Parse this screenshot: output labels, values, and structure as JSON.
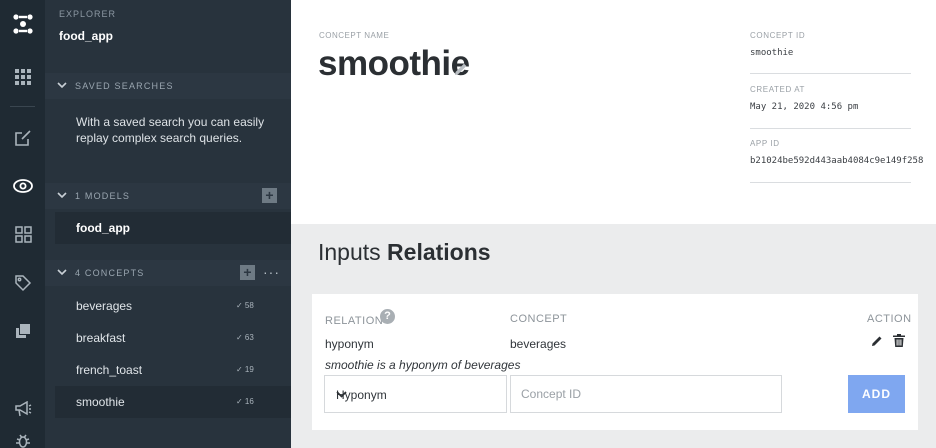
{
  "rail": {
    "icons": [
      "clarifai-logo-icon",
      "grid-icon",
      "edit-icon",
      "eye-icon",
      "dashboard-icon",
      "tag-icon",
      "copy-icon",
      "megaphone-icon",
      "bug-icon"
    ]
  },
  "sidebar": {
    "explorer_label": "EXPLORER",
    "app_name": "food_app",
    "saved_searches": {
      "title": "SAVED SEARCHES",
      "text": "With a saved search you can easily replay complex search queries."
    },
    "models": {
      "title": "1 MODELS",
      "items": [
        {
          "label": "food_app"
        }
      ]
    },
    "concepts": {
      "title": "4 CONCEPTS",
      "more_label": "···",
      "items": [
        {
          "label": "beverages",
          "count": "✓ 58"
        },
        {
          "label": "breakfast",
          "count": "✓ 63"
        },
        {
          "label": "french_toast",
          "count": "✓ 19"
        },
        {
          "label": "smoothie",
          "count": "✓ 16"
        }
      ]
    },
    "plus_label": "+"
  },
  "concept": {
    "name_label": "CONCEPT NAME",
    "name": "smoothie",
    "id_label": "CONCEPT ID",
    "id": "smoothie",
    "created_label": "CREATED AT",
    "created": "May 21, 2020 4:56 pm",
    "app_id_label": "APP ID",
    "app_id": "b21024be592d443aab4084c9e149f258"
  },
  "relations": {
    "title_prefix": "Inputs",
    "title_main": "Relations",
    "col_relation": "RELATION",
    "col_concept": "CONCEPT",
    "col_action": "ACTION",
    "help": "?",
    "rows": [
      {
        "relation": "hyponym",
        "concept": "beverages",
        "description": "smoothie is a hyponym of beverages"
      }
    ],
    "select_value": "Hyponym",
    "input_placeholder": "Concept ID",
    "add_label": "ADD"
  },
  "colors": {
    "rail": "#1f2a33",
    "sidebar": "#28333d",
    "accent_button": "#7fa7f0",
    "background": "#ebeced"
  }
}
